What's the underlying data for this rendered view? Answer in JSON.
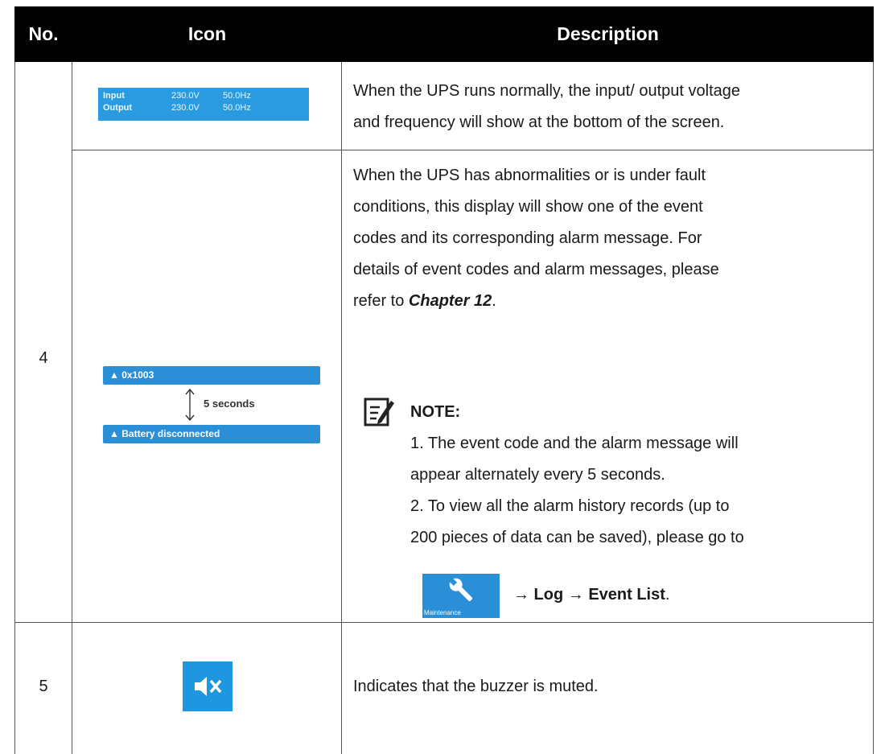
{
  "headers": {
    "no": "No.",
    "icon": "Icon",
    "description": "Description"
  },
  "row4": {
    "number": "4",
    "lcd": {
      "input_label": "Input",
      "input_voltage": "230.0V",
      "input_freq": "50.0Hz",
      "output_label": "Output",
      "output_voltage": "230.0V",
      "output_freq": "50.0Hz"
    },
    "desc1_line1": "When the UPS runs normally, the input/ output voltage",
    "desc1_line2": "and frequency will show at the bottom of the screen.",
    "alarm": {
      "code": "0x1003",
      "interval": "5 seconds",
      "message": "Battery disconnected"
    },
    "desc2_lines": [
      "When the UPS has abnormalities or is under fault",
      "conditions, this display will show one of the event",
      "codes and its corresponding alarm message. For",
      "details of event codes and alarm messages, please"
    ],
    "refer_prefix": "refer to ",
    "chapter": "Chapter 12",
    "refer_suffix": ".",
    "note_title": "NOTE:",
    "note_lines": [
      "1. The event code and the alarm message will",
      "appear alternately every 5 seconds.",
      "2. To view all the alarm history records (up to",
      "200 pieces of data can be saved), please go to"
    ],
    "maintenance_label": "Maintenance",
    "nav_path": "→ Log → Event List",
    "nav_suffix": "."
  },
  "row5": {
    "number": "5",
    "description": "Indicates that the buzzer is muted."
  }
}
